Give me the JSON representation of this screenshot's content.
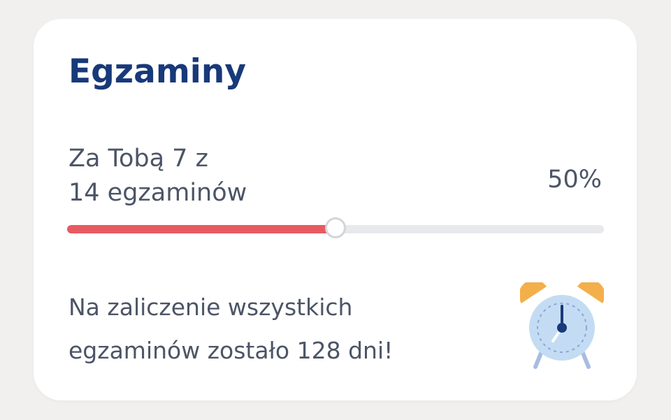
{
  "card": {
    "title": "Egzaminy",
    "progress": {
      "line1": "Za Tobą 7 z",
      "line2": "14 egzaminów",
      "percent_label": "50%",
      "completed": 7,
      "total": 14,
      "fraction": 0.5
    },
    "message": {
      "line1": "Na zaliczenie wszystkich",
      "line2": "egzaminów zostało 128 dni!"
    },
    "illustration": "alarm-clock-icon"
  },
  "colors": {
    "title": "#18397a",
    "text": "#4c5566",
    "progress_fill": "#e85a61",
    "progress_track": "#e8e9ec",
    "clock_face": "#c4dcf3",
    "clock_bells": "#f3b04a"
  }
}
